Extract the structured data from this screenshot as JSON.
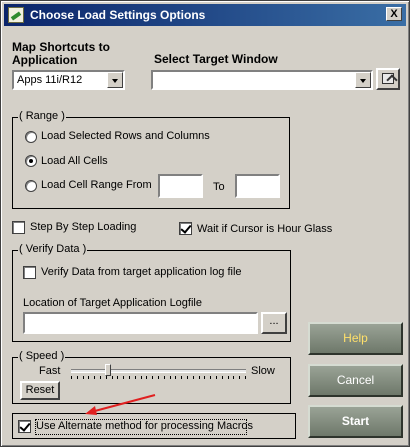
{
  "window": {
    "title": "Choose Load Settings Options",
    "close_glyph": "X"
  },
  "map_shortcuts": {
    "label": "Map Shortcuts to Application",
    "selected": "Apps 11i/R12"
  },
  "target_window": {
    "label": "Select Target Window",
    "selected": ""
  },
  "range": {
    "title": "( Range )",
    "options": [
      {
        "label": "Load Selected Rows and Columns",
        "selected": false
      },
      {
        "label": "Load All Cells",
        "selected": true
      },
      {
        "label": "Load Cell Range From",
        "selected": false
      }
    ],
    "from_value": "",
    "to_label": "To",
    "to_value": ""
  },
  "step_by_step": {
    "label": "Step By Step Loading",
    "checked": false
  },
  "wait_cursor": {
    "label": "Wait if Cursor is Hour Glass",
    "checked": true
  },
  "verify": {
    "title": "( Verify Data )",
    "checkbox_label": "Verify Data from target application log file",
    "checked": false,
    "logfile_label": "Location of Target Application Logfile",
    "logfile_value": "",
    "browse_label": "..."
  },
  "speed": {
    "title": "( Speed )",
    "fast_label": "Fast",
    "slow_label": "Slow",
    "reset_label": "Reset",
    "level_fraction": 0.2
  },
  "alternate_macros": {
    "label": "Use Alternate method for processing Macros",
    "checked": true
  },
  "buttons": {
    "help": "Help",
    "cancel": "Cancel",
    "start": "Start"
  },
  "annotation": {
    "arrow_color": "#e02020"
  }
}
